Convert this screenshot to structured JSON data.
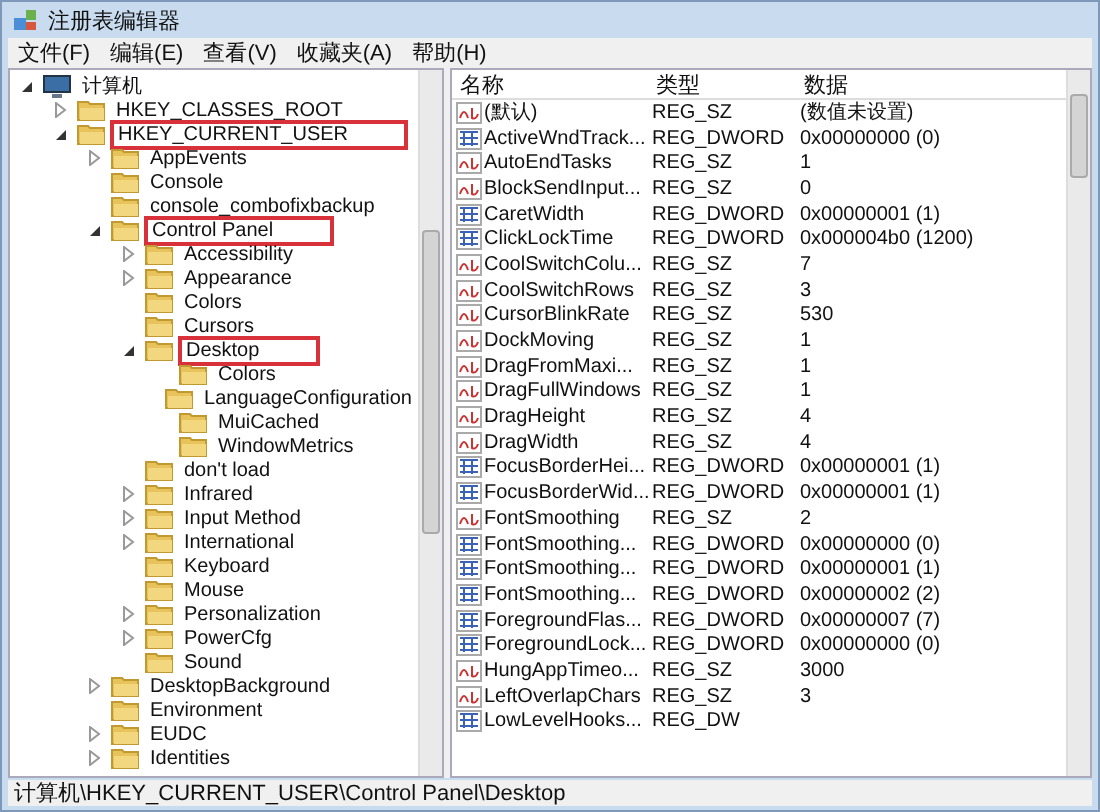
{
  "window": {
    "title": "注册表编辑器"
  },
  "menu": [
    "文件(F)",
    "编辑(E)",
    "查看(V)",
    "收藏夹(A)",
    "帮助(H)"
  ],
  "tree": [
    {
      "label": "计算机",
      "expanded": true,
      "marked": false,
      "kind": "computer",
      "children": [
        {
          "label": "HKEY_CLASSES_ROOT",
          "expanded": false,
          "marked": false
        },
        {
          "label": "HKEY_CURRENT_USER",
          "expanded": true,
          "marked": true,
          "children": [
            {
              "label": "AppEvents",
              "expanded": false,
              "marked": false
            },
            {
              "label": "Console",
              "marked": false
            },
            {
              "label": "console_combofixbackup",
              "marked": false
            },
            {
              "label": "Control Panel",
              "expanded": true,
              "marked": true,
              "children": [
                {
                  "label": "Accessibility",
                  "expanded": false,
                  "marked": false
                },
                {
                  "label": "Appearance",
                  "expanded": false,
                  "marked": false
                },
                {
                  "label": "Colors",
                  "marked": false
                },
                {
                  "label": "Cursors",
                  "marked": false
                },
                {
                  "label": "Desktop",
                  "expanded": true,
                  "marked": true,
                  "children": [
                    {
                      "label": "Colors",
                      "marked": false
                    },
                    {
                      "label": "LanguageConfiguration",
                      "marked": false
                    },
                    {
                      "label": "MuiCached",
                      "marked": false
                    },
                    {
                      "label": "WindowMetrics",
                      "marked": false
                    }
                  ]
                },
                {
                  "label": "don't load",
                  "marked": false
                },
                {
                  "label": "Infrared",
                  "expanded": false,
                  "marked": false
                },
                {
                  "label": "Input Method",
                  "expanded": false,
                  "marked": false
                },
                {
                  "label": "International",
                  "expanded": false,
                  "marked": false
                },
                {
                  "label": "Keyboard",
                  "marked": false
                },
                {
                  "label": "Mouse",
                  "marked": false
                },
                {
                  "label": "Personalization",
                  "expanded": false,
                  "marked": false
                },
                {
                  "label": "PowerCfg",
                  "expanded": false,
                  "marked": false
                },
                {
                  "label": "Sound",
                  "marked": false
                }
              ]
            },
            {
              "label": "DesktopBackground",
              "expanded": false,
              "marked": false
            },
            {
              "label": "Environment",
              "marked": false
            },
            {
              "label": "EUDC",
              "expanded": false,
              "marked": false
            },
            {
              "label": "Identities",
              "expanded": false,
              "marked": false
            }
          ]
        }
      ]
    }
  ],
  "table": {
    "columns": [
      "名称",
      "类型",
      "数据"
    ],
    "rows": [
      {
        "kind": "sz",
        "name": "(默认)",
        "type": "REG_SZ",
        "data": "(数值未设置)"
      },
      {
        "kind": "dword",
        "name": "ActiveWndTrack...",
        "type": "REG_DWORD",
        "data": "0x00000000 (0)"
      },
      {
        "kind": "sz",
        "name": "AutoEndTasks",
        "type": "REG_SZ",
        "data": "1"
      },
      {
        "kind": "sz",
        "name": "BlockSendInput...",
        "type": "REG_SZ",
        "data": "0"
      },
      {
        "kind": "dword",
        "name": "CaretWidth",
        "type": "REG_DWORD",
        "data": "0x00000001 (1)"
      },
      {
        "kind": "dword",
        "name": "ClickLockTime",
        "type": "REG_DWORD",
        "data": "0x000004b0 (1200)"
      },
      {
        "kind": "sz",
        "name": "CoolSwitchColu...",
        "type": "REG_SZ",
        "data": "7"
      },
      {
        "kind": "sz",
        "name": "CoolSwitchRows",
        "type": "REG_SZ",
        "data": "3"
      },
      {
        "kind": "sz",
        "name": "CursorBlinkRate",
        "type": "REG_SZ",
        "data": "530"
      },
      {
        "kind": "sz",
        "name": "DockMoving",
        "type": "REG_SZ",
        "data": "1"
      },
      {
        "kind": "sz",
        "name": "DragFromMaxi...",
        "type": "REG_SZ",
        "data": "1"
      },
      {
        "kind": "sz",
        "name": "DragFullWindows",
        "type": "REG_SZ",
        "data": "1"
      },
      {
        "kind": "sz",
        "name": "DragHeight",
        "type": "REG_SZ",
        "data": "4"
      },
      {
        "kind": "sz",
        "name": "DragWidth",
        "type": "REG_SZ",
        "data": "4"
      },
      {
        "kind": "dword",
        "name": "FocusBorderHei...",
        "type": "REG_DWORD",
        "data": "0x00000001 (1)"
      },
      {
        "kind": "dword",
        "name": "FocusBorderWid...",
        "type": "REG_DWORD",
        "data": "0x00000001 (1)"
      },
      {
        "kind": "sz",
        "name": "FontSmoothing",
        "type": "REG_SZ",
        "data": "2"
      },
      {
        "kind": "dword",
        "name": "FontSmoothing...",
        "type": "REG_DWORD",
        "data": "0x00000000 (0)"
      },
      {
        "kind": "dword",
        "name": "FontSmoothing...",
        "type": "REG_DWORD",
        "data": "0x00000001 (1)"
      },
      {
        "kind": "dword",
        "name": "FontSmoothing...",
        "type": "REG_DWORD",
        "data": "0x00000002 (2)"
      },
      {
        "kind": "dword",
        "name": "ForegroundFlas...",
        "type": "REG_DWORD",
        "data": "0x00000007 (7)"
      },
      {
        "kind": "dword",
        "name": "ForegroundLock...",
        "type": "REG_DWORD",
        "data": "0x00000000 (0)"
      },
      {
        "kind": "sz",
        "name": "HungAppTimeo...",
        "type": "REG_SZ",
        "data": "3000"
      },
      {
        "kind": "sz",
        "name": "LeftOverlapChars",
        "type": "REG_SZ",
        "data": "3"
      },
      {
        "kind": "dword",
        "name": "LowLevelHooks...",
        "type": "REG_DW"
      }
    ]
  },
  "status_bar": "计算机\\HKEY_CURRENT_USER\\Control Panel\\Desktop"
}
